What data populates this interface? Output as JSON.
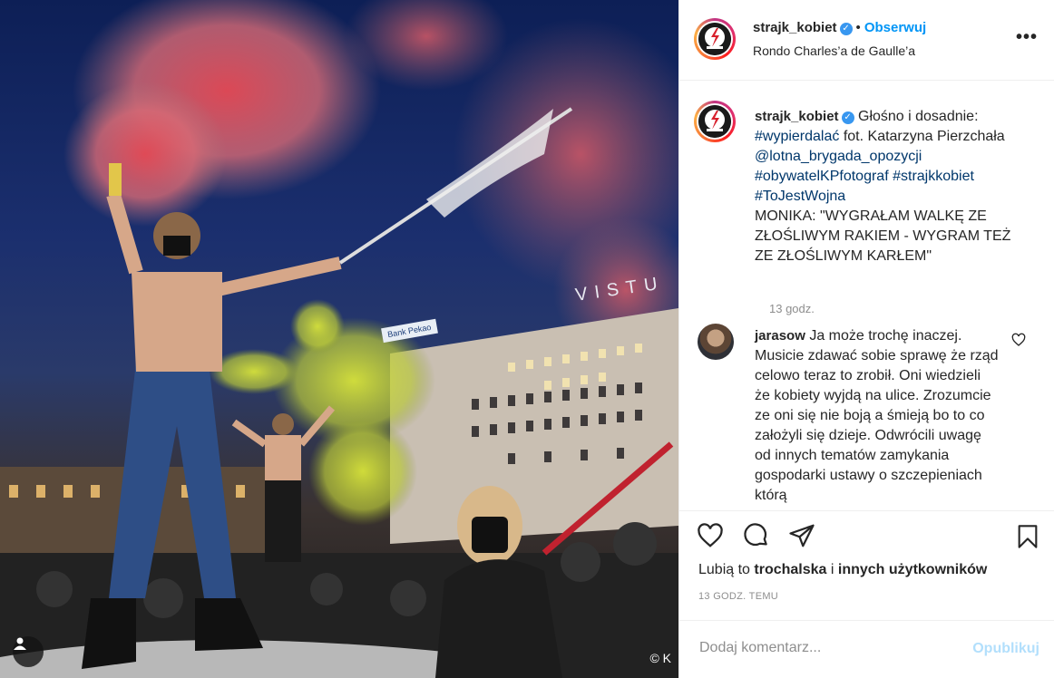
{
  "post": {
    "username": "strajk_kobiet",
    "verified_icon": "verified-badge-icon",
    "dot": "•",
    "follow_label": "Obserwuj",
    "location": "Rondo Charles’a de Gaulle’a",
    "more_label": "•••"
  },
  "photo": {
    "watermark": "© K",
    "sign_text": "VISTU",
    "bank_sign": "Bank Pekao"
  },
  "caption": {
    "username": "strajk_kobiet",
    "text_intro": " Głośno i dosadnie: ",
    "tag1": "#wypierdalać",
    "text_credit": " fot. Katarzyna Pierzchała ",
    "tag2": "@lotna_brygada_opozycji",
    "tag3": "#obywatelKPfotograf",
    "tag4": "#strajkkobiet",
    "tag5": "#ToJestWojna",
    "quote": "MONIKA: \"WYGRAŁAM WALKĘ ZE ZŁOŚLIWYM RAKIEM - WYGRAM TEŻ ZE ZŁOŚLIWYM KARŁEM\"",
    "time": "13 godz."
  },
  "comment": {
    "username": "jarasow",
    "text": " Ja może trochę inaczej. Musicie zdawać sobie sprawę że rząd celowo teraz to zrobił. Oni wiedzieli że kobiety wyjdą na ulice. Zrozumcie ze oni się nie boją a śmieją bo to co założyli się dzieje. Odwrócili uwagę od innych tematów zamykania gospodarki ustawy o szczepieniach którą"
  },
  "likes": {
    "prefix": "Lubią to ",
    "user": "trochalska",
    "middle": " i ",
    "others": "innych użytkowników"
  },
  "time_ago": "13 GODZ. TEMU",
  "add_comment": {
    "placeholder": "Dodaj komentarz...",
    "publish_label": "Opublikuj"
  },
  "colors": {
    "accent": "#0095f6",
    "publish_disabled": "#b2dffc",
    "hashtag": "#00376b"
  }
}
